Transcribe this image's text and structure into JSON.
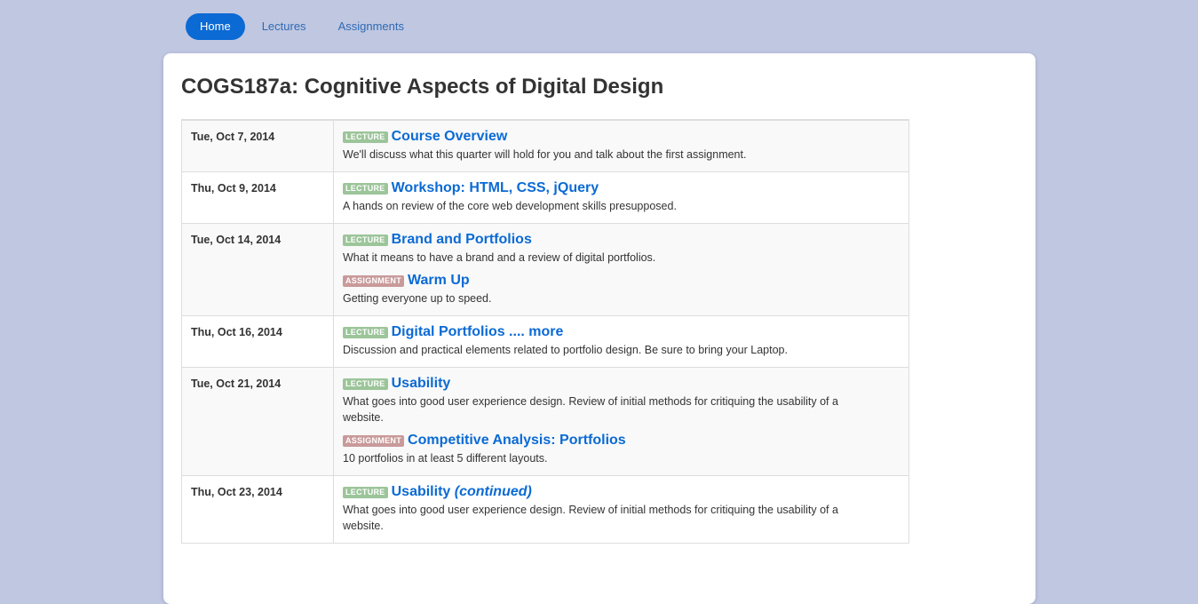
{
  "nav": {
    "items": [
      {
        "label": "Home",
        "active": true
      },
      {
        "label": "Lectures",
        "active": false
      },
      {
        "label": "Assignments",
        "active": false
      }
    ]
  },
  "page": {
    "title": "COGS187a: Cognitive Aspects of Digital Design"
  },
  "badges": {
    "lecture": "LECTURE",
    "assignment": "ASSIGNMENT"
  },
  "colors": {
    "background": "#c0c7e1",
    "accent": "#0b6ad4",
    "lecture_badge": "#9cc59a",
    "assignment_badge": "#c99a9a"
  },
  "schedule": [
    {
      "date": "Tue, Oct 7, 2014",
      "entries": [
        {
          "type": "lecture",
          "title": "Course Overview",
          "title_suffix": "",
          "description": "We'll discuss what this quarter will hold for you and talk about the first assignment."
        }
      ]
    },
    {
      "date": "Thu, Oct 9, 2014",
      "entries": [
        {
          "type": "lecture",
          "title": "Workshop: HTML, CSS, jQuery",
          "title_suffix": "",
          "description": "A hands on review of the core web development skills presupposed."
        }
      ]
    },
    {
      "date": "Tue, Oct 14, 2014",
      "entries": [
        {
          "type": "lecture",
          "title": "Brand and Portfolios",
          "title_suffix": "",
          "description": "What it means to have a brand and a review of digital portfolios."
        },
        {
          "type": "assignment",
          "title": "Warm Up",
          "title_suffix": "",
          "description": "Getting everyone up to speed."
        }
      ]
    },
    {
      "date": "Thu, Oct 16, 2014",
      "entries": [
        {
          "type": "lecture",
          "title": "Digital Portfolios .... more",
          "title_suffix": "",
          "description": "Discussion and practical elements related to portfolio design. Be sure to bring your Laptop."
        }
      ]
    },
    {
      "date": "Tue, Oct 21, 2014",
      "entries": [
        {
          "type": "lecture",
          "title": "Usability",
          "title_suffix": "",
          "description": "What goes into good user experience design. Review of initial methods for critiquing the usability of a website."
        },
        {
          "type": "assignment",
          "title": "Competitive Analysis: Portfolios",
          "title_suffix": "",
          "description": "10 portfolios in at least 5 different layouts."
        }
      ]
    },
    {
      "date": "Thu, Oct 23, 2014",
      "entries": [
        {
          "type": "lecture",
          "title": "Usability",
          "title_suffix": "(continued)",
          "description": "What goes into good user experience design. Review of initial methods for critiquing the usability of a website."
        }
      ]
    }
  ]
}
